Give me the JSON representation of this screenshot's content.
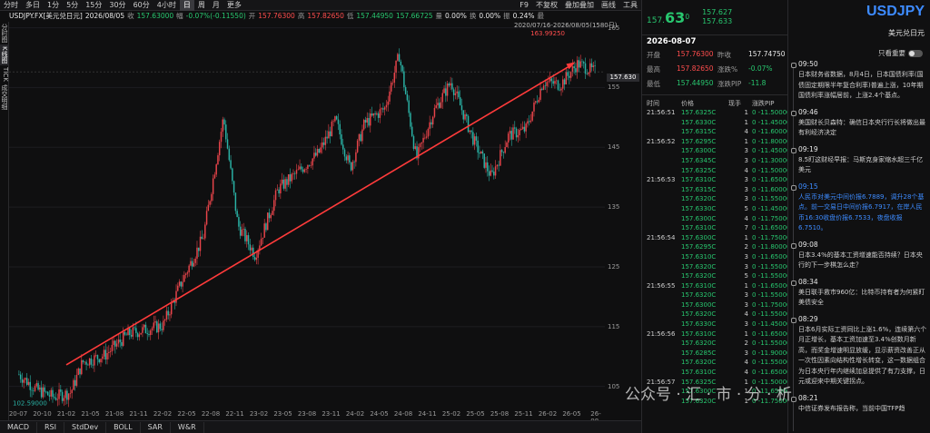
{
  "topbar": {
    "periods": [
      "分时",
      "多日",
      "1分",
      "5分",
      "15分",
      "30分",
      "60分",
      "4小时",
      "日",
      "周",
      "月",
      "更多"
    ],
    "active": "日",
    "right": [
      "F9",
      "不复权",
      "叠加叠加",
      "画线",
      "工具"
    ]
  },
  "info": {
    "symbol": "USDJPY.FX[美元兑日元]",
    "date": "2026/08/05",
    "close_label": "收",
    "close": "157.63000",
    "amp_label": "幅",
    "amp": "-0.07%(-0.11550)",
    "open_label": "开",
    "open": "157.76300",
    "high_label": "高",
    "high": "157.82650",
    "low_label": "低",
    "low": "157.44950",
    "avg": "157.66725",
    "vol_label": "量",
    "vol": "0.00%",
    "turn_label": "换",
    "turn": "0.00%",
    "swing_label": "振",
    "swing": "0.24%",
    "more": "最"
  },
  "range_label": "2020/07/16-2026/08/05(1580日)",
  "sidetabs": [
    "分时图",
    "K线图",
    "TICK",
    "成交明细"
  ],
  "chart_data": {
    "type": "candlestick",
    "title": "USDJPY.FX[美元兑日元]",
    "ylim": [
      101,
      166
    ],
    "y_ticks": [
      105,
      115,
      125,
      135,
      145,
      155,
      165
    ],
    "x_ticks": [
      "20-07",
      "20-10",
      "21-02",
      "21-05",
      "21-08",
      "21-11",
      "22-02",
      "22-05",
      "22-08",
      "22-11",
      "23-02",
      "23-05",
      "23-08",
      "23-11",
      "24-02",
      "24-05",
      "24-08",
      "24-11",
      "25-02",
      "25-05",
      "25-08",
      "25-11",
      "26-02",
      "26-05",
      "26-08"
    ],
    "high_label": "163.99250",
    "low_label": "102.59000",
    "last_price": "157.630",
    "trendline": {
      "from": [
        "21-02",
        108.6
      ],
      "to": [
        "26-05",
        158.8
      ]
    }
  },
  "indicators": [
    "MACD",
    "RSI",
    "StdDev",
    "BOLL",
    "SAR",
    "W&R"
  ],
  "quote": {
    "last_int": "157.",
    "last_big": "63",
    "last_sup": "0",
    "bid": "157.627",
    "ask": "157.633"
  },
  "detail": {
    "date": "2026-08-07",
    "kv": [
      [
        "开盘",
        "157.76300",
        "昨收",
        "157.74750"
      ],
      [
        "最高",
        "157.82650",
        "涨跌%",
        "-0.07%"
      ],
      [
        "最低",
        "157.44950",
        "涨跌PIP",
        "-11.8"
      ]
    ],
    "headers": [
      "时间",
      "价格",
      "现手",
      "涨跌PIP"
    ]
  },
  "ticks": [
    [
      "21:56:51",
      "157.6325C",
      "1",
      "0 -11.5000C"
    ],
    [
      "",
      "157.6330C",
      "1",
      "0 -11.4500C"
    ],
    [
      "",
      "157.6315C",
      "4",
      "0 -11.6000C"
    ],
    [
      "21:56:52",
      "157.6295C",
      "1",
      "0 -11.8000C"
    ],
    [
      "",
      "157.6300C",
      "3",
      "0 -11.4500C"
    ],
    [
      "",
      "157.6345C",
      "3",
      "0 -11.3000C"
    ],
    [
      "",
      "157.6325C",
      "4",
      "0 -11.5000C"
    ],
    [
      "21:56:53",
      "157.6310C",
      "3",
      "0 -11.6500C"
    ],
    [
      "",
      "157.6315C",
      "3",
      "0 -11.6000C"
    ],
    [
      "",
      "157.6320C",
      "3",
      "0 -11.5500C"
    ],
    [
      "",
      "157.6330C",
      "5",
      "0 -11.4500C"
    ],
    [
      "",
      "157.6300C",
      "4",
      "0 -11.7500C"
    ],
    [
      "",
      "157.6310C",
      "7",
      "0 -11.6500C"
    ],
    [
      "21:56:54",
      "157.6300C",
      "1",
      "0 -11.7500C"
    ],
    [
      "",
      "157.6295C",
      "2",
      "0 -11.8000C"
    ],
    [
      "",
      "157.6310C",
      "3",
      "0 -11.6500C"
    ],
    [
      "",
      "157.6320C",
      "3",
      "0 -11.5500C"
    ],
    [
      "",
      "157.6320C",
      "5",
      "0 -11.5500C"
    ],
    [
      "21:56:55",
      "157.6310C",
      "1",
      "0 -11.6500C"
    ],
    [
      "",
      "157.6320C",
      "3",
      "0 -11.5500C"
    ],
    [
      "",
      "157.6300C",
      "3",
      "0 -11.7500C"
    ],
    [
      "",
      "157.6320C",
      "4",
      "0 -11.5500C"
    ],
    [
      "",
      "157.6330C",
      "3",
      "0 -11.4500C"
    ],
    [
      "21:56:56",
      "157.6310C",
      "1",
      "0 -11.6500C"
    ],
    [
      "",
      "157.6320C",
      "2",
      "0 -11.5500C"
    ],
    [
      "",
      "157.6285C",
      "3",
      "0 -11.9000C"
    ],
    [
      "",
      "157.6320C",
      "4",
      "0 -11.5500C"
    ],
    [
      "",
      "157.6310C",
      "4",
      "0 -11.6500C"
    ],
    [
      "21:56:57",
      "157.6325C",
      "1",
      "0 -11.5000C"
    ],
    [
      "",
      "157.6300C",
      "1",
      "0 -11.6500C"
    ],
    [
      "",
      "157.6320C",
      "1",
      "0 -11.7500C"
    ]
  ],
  "right": {
    "symbol": "USDJPY",
    "name": "美元兑日元",
    "important": "只看重要"
  },
  "news": [
    {
      "time": "09:50",
      "text": "日本财务省数据，8月4日，日本国债利率(国债固定期限半年复合利率)普遍上涨，10年期国债利率涨幅居前，上涨2.4个基点。",
      "hl": false
    },
    {
      "time": "09:46",
      "text": "美国财长贝森特：确信日本央行行长将做出最有利经济决定",
      "hl": false
    },
    {
      "time": "09:19",
      "text": "8.5盯这财经早报：马斯克身家缩水超三千亿美元",
      "hl": false
    },
    {
      "time": "09:15",
      "text": "人民币对美元中间价报6.7889，调升28个基点。前一交易日中间价报6.7917，在岸人民币16:30收盘价报6.7533，夜盘收报6.7510。",
      "hl": true
    },
    {
      "time": "09:08",
      "text": "日本3.4%的基本工资增速能否持续？日本央行的下一步棋怎么走？",
      "hl": false
    },
    {
      "time": "08:34",
      "text": "美日联手救市960亿：比特币持有者为何紧盯美债安全",
      "hl": false
    },
    {
      "time": "08:29",
      "text": "日本6月实际工资同比上涨1.6%，连续第六个月正增长，基本工资加速至3.4%创数月新高，而奖金增速明显放缓，显示薪资改善正从一次性因素向结构性增长转变，这一数据组合为日本央行年内继续加息提供了有力支撑，日元或迎来中期关键拐点。",
      "hl": false
    },
    {
      "time": "08:21",
      "text": "中信证券发布报告称，当前中国TFP趋",
      "hl": false
    }
  ],
  "watermark": "公众号 · 汇 · 市 · 分 · 析"
}
